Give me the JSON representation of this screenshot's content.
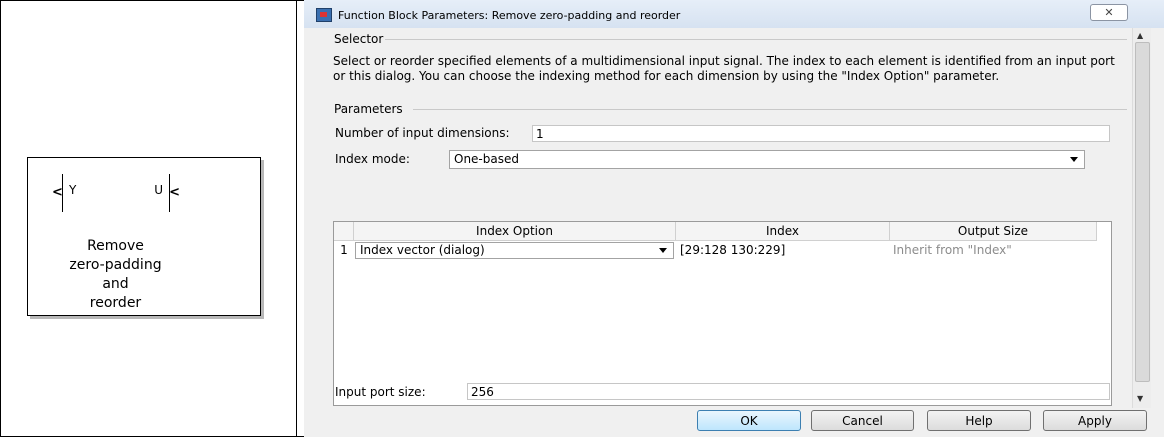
{
  "model": {
    "block_port_in": "Y",
    "block_port_out": "U",
    "block_name_lines": [
      "Remove",
      "zero-padding",
      "and",
      "reorder"
    ]
  },
  "dialog": {
    "title": "Function Block Parameters: Remove zero-padding and reorder",
    "close_label": "✕",
    "section_title": "Selector",
    "description": "Select or reorder specified elements of a multidimensional input signal. The index to each element is identified from an input port or this dialog. You can choose the indexing method for each dimension by using the \"Index Option\" parameter.",
    "params_title": "Parameters",
    "num_dims_label": "Number of input dimensions:",
    "num_dims_value": "1",
    "index_mode_label": "Index mode:",
    "index_mode_value": "One-based",
    "table": {
      "headers": [
        "Index Option",
        "Index",
        "Output Size"
      ],
      "rows": [
        {
          "num": "1",
          "option": "Index vector (dialog)",
          "index": "[29:128 130:229]",
          "output_size": "Inherit from \"Index\""
        }
      ]
    },
    "input_port_size_label": "Input port size:",
    "input_port_size_value": "256",
    "buttons": {
      "ok": "OK",
      "cancel": "Cancel",
      "help": "Help",
      "apply": "Apply"
    }
  }
}
